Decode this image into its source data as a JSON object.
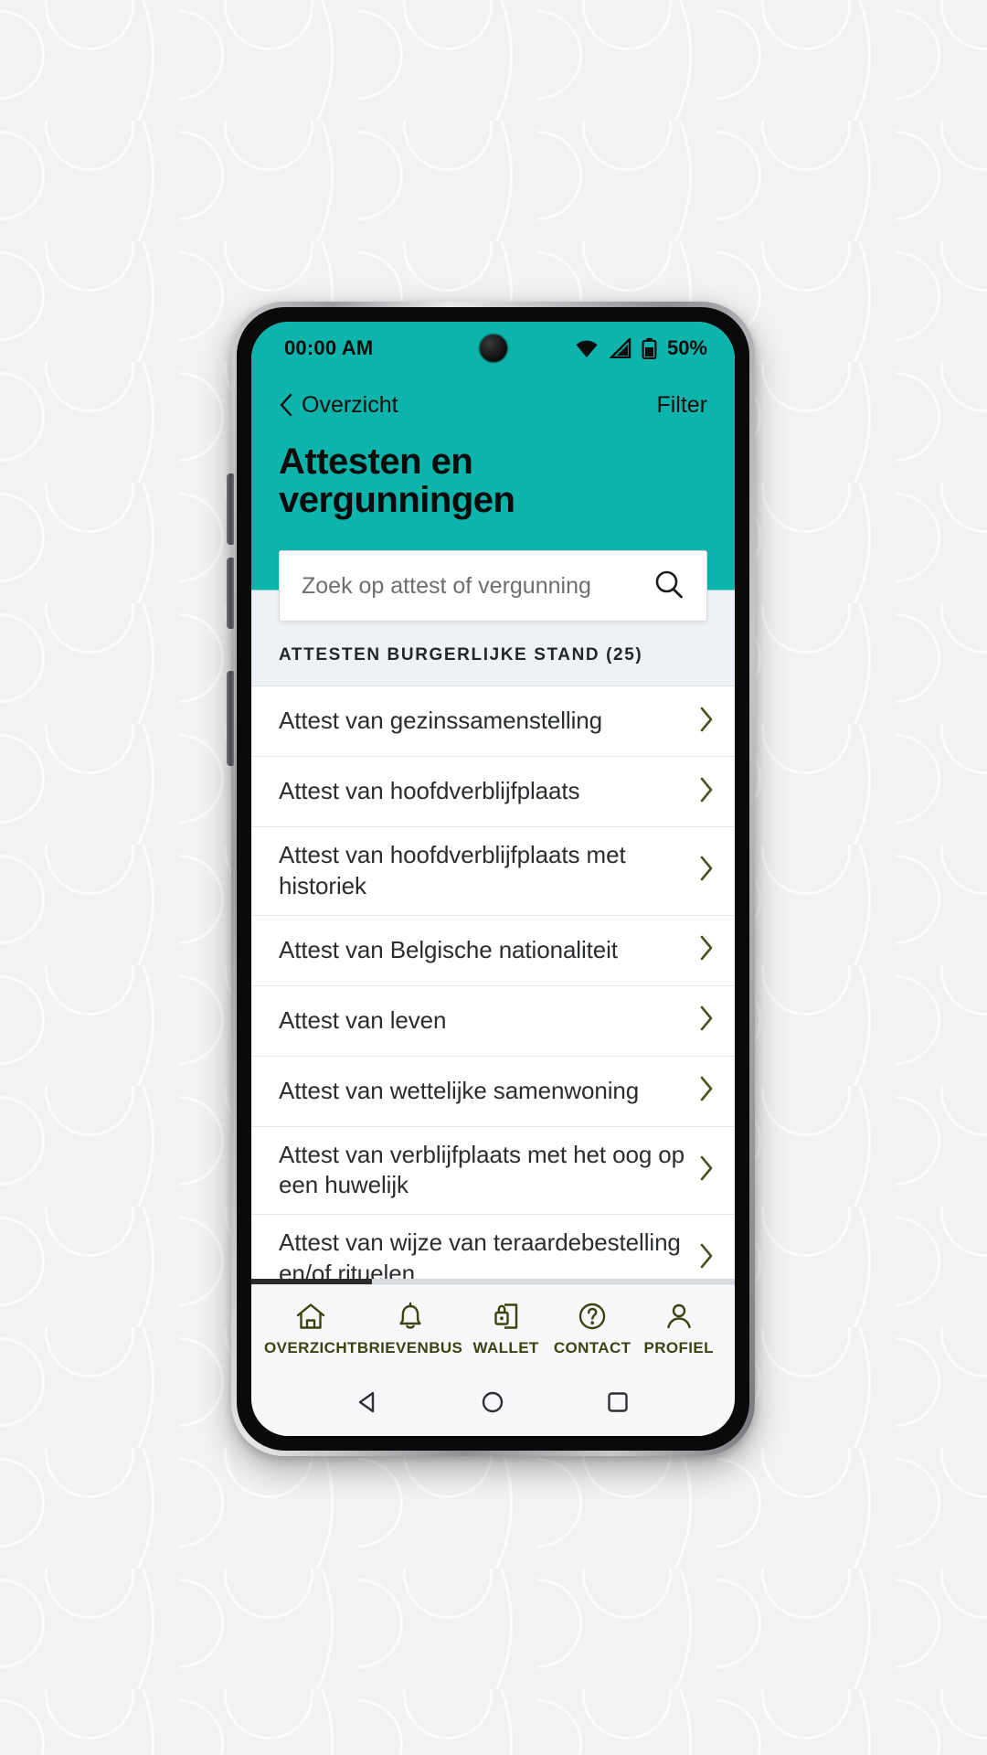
{
  "statusbar": {
    "time": "00:00 AM",
    "battery_percent": "50%",
    "icons": [
      "wifi-icon",
      "cellular-signal-icon",
      "battery-icon"
    ]
  },
  "header": {
    "back_label": "Overzicht",
    "filter_label": "Filter",
    "title": "Attesten en vergunningen",
    "background_color": "#0db4ab"
  },
  "search": {
    "placeholder": "Zoek op attest of vergunning",
    "value": ""
  },
  "section": {
    "label": "ATTESTEN BURGERLIJKE STAND (25)"
  },
  "list": {
    "items": [
      {
        "label": "Attest van gezinssamenstelling"
      },
      {
        "label": "Attest van hoofdverblijfplaats"
      },
      {
        "label": "Attest van hoofdverblijfplaats met historiek"
      },
      {
        "label": "Attest van Belgische nationaliteit"
      },
      {
        "label": "Attest van leven"
      },
      {
        "label": "Attest van wettelijke samenwoning"
      },
      {
        "label": "Attest van verblijfplaats met het oog op een huwelijk"
      },
      {
        "label": "Attest van wijze van teraardebestelling en/of rituelen"
      }
    ],
    "scroll_progress_percent": 25,
    "chevron_color": "#4b5320"
  },
  "tabbar": {
    "items": [
      {
        "label": "OVERZICHT",
        "icon": "home-icon"
      },
      {
        "label": "BRIEVENBUS",
        "icon": "bell-icon"
      },
      {
        "label": "WALLET",
        "icon": "wallet-lock-icon"
      },
      {
        "label": "CONTACT",
        "icon": "question-circle-icon"
      },
      {
        "label": "PROFIEL",
        "icon": "person-icon"
      }
    ],
    "accent_color": "#3d4210"
  },
  "androidnav": {
    "items": [
      "back-triangle-icon",
      "home-circle-icon",
      "recents-square-icon"
    ]
  }
}
